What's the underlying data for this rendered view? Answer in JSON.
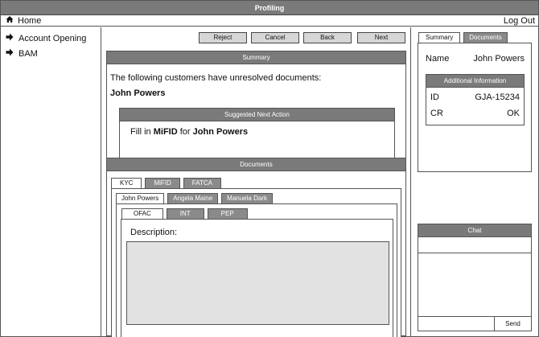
{
  "window": {
    "title": "Profiling"
  },
  "navbar": {
    "home_label": "Home",
    "logout_label": "Log Out"
  },
  "sidebar": {
    "items": [
      {
        "label": "Account Opening",
        "icon": "arrow-right-icon"
      },
      {
        "label": "BAM",
        "icon": "arrow-right-icon"
      }
    ]
  },
  "toolbar": {
    "reject": "Reject",
    "cancel": "Cancel",
    "back": "Back",
    "next": "Next"
  },
  "summary": {
    "header": "Summary",
    "text": "The following customers have unresolved documents:",
    "customer": "John Powers",
    "next_action": {
      "header": "Suggested Next Action",
      "prefix": "Fill in",
      "doc": "MiFID",
      "middle": "for",
      "customer": "John Powers"
    }
  },
  "documents": {
    "header": "Documents",
    "doc_tabs": [
      "KYC",
      "MiFID",
      "FATCA"
    ],
    "customer_tabs": [
      "John Powers",
      "Angela Maine",
      "Manuela Dark"
    ],
    "check_tabs": [
      "OFAC",
      "INT",
      "PEP"
    ],
    "description_label": "Description:"
  },
  "right_panel": {
    "tabs": [
      "Summary",
      "Documents"
    ],
    "name_label": "Name",
    "name_value": "John Powers",
    "additional": {
      "header": "Additional Information",
      "rows": [
        {
          "label": "ID",
          "value": "GJA-15234"
        },
        {
          "label": "CR",
          "value": "OK"
        }
      ]
    }
  },
  "chat": {
    "header": "Chat",
    "send_label": "Send"
  }
}
